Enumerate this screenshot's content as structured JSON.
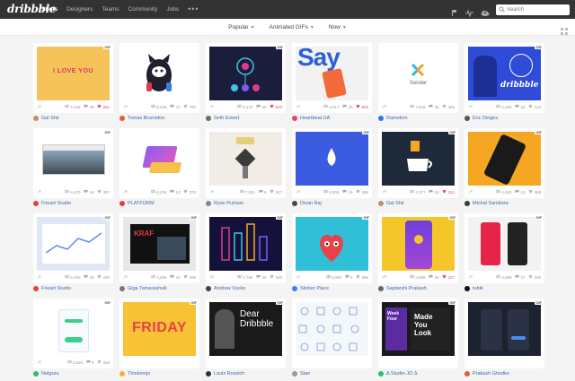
{
  "nav": {
    "logo": "dribbble",
    "items": [
      "Shots",
      "Designers",
      "Teams",
      "Community",
      "Jobs"
    ],
    "more": "•••",
    "search_placeholder": "Search"
  },
  "filters": {
    "sort": "Popular",
    "type": "Animated GIFs",
    "time": "Now"
  },
  "thumb_text": {
    "love": "I LOVE YOU",
    "say": "Say",
    "xender": "Xender",
    "dribbble_script": "dribbble",
    "friday": "FRIDAY",
    "dear": "Dear",
    "dribbble_word": "Dribbble",
    "made": "Made",
    "you": "You",
    "look": "Look",
    "kraft": "KRAF",
    "week": "Week",
    "four": "Four"
  },
  "shots": [
    {
      "author": "Gal Shir",
      "views": "7,046",
      "comments": "49",
      "likes": "801",
      "liked": true,
      "avatar_color": "#c58b6a",
      "gif": true
    },
    {
      "author": "Tomas Brunsdon",
      "views": "8,040",
      "comments": "47",
      "likes": "760",
      "liked": false,
      "avatar_color": "#e05f3a",
      "gif": false
    },
    {
      "author": "Seth Eckert",
      "views": "5,137",
      "comments": "55",
      "likes": "548",
      "liked": true,
      "avatar_color": "#6c6c6c",
      "gif": true
    },
    {
      "author": "Heartbeat UA",
      "views": "3,617",
      "comments": "29",
      "likes": "509",
      "liked": true,
      "avatar_color": "#e8416c",
      "gif": false
    },
    {
      "author": "Ramotion",
      "views": "7,918",
      "comments": "36",
      "likes": "408",
      "liked": false,
      "avatar_color": "#2e7bd6",
      "gif": false
    },
    {
      "author": "Eric Dinges",
      "views": "4,492",
      "comments": "24",
      "likes": "413",
      "liked": false,
      "avatar_color": "#555555",
      "gif": true
    },
    {
      "author": "Fireart Studio",
      "views": "5,470",
      "comments": "16",
      "likes": "397",
      "liked": false,
      "avatar_color": "#e83e3e",
      "gif": true
    },
    {
      "author": "PLATFORM",
      "views": "6,208",
      "comments": "13",
      "likes": "375",
      "liked": false,
      "avatar_color": "#e83e3e",
      "gif": false
    },
    {
      "author": "Ryan Putnam",
      "views": "7,051",
      "comments": "5",
      "likes": "347",
      "liked": false,
      "avatar_color": "#888888",
      "gif": false
    },
    {
      "author": "Divan Raj",
      "views": "6,806",
      "comments": "19",
      "likes": "386",
      "liked": false,
      "avatar_color": "#4a4a4a",
      "gif": true
    },
    {
      "author": "Gal Shir",
      "views": "4,377",
      "comments": "19",
      "likes": "334",
      "liked": true,
      "avatar_color": "#c58b6a",
      "gif": true
    },
    {
      "author": "Michal Sambora",
      "views": "4,450",
      "comments": "15",
      "likes": "388",
      "liked": false,
      "avatar_color": "#3c3c3c",
      "gif": true
    },
    {
      "author": "Fireart Studio",
      "views": "5,493",
      "comments": "18",
      "likes": "335",
      "liked": false,
      "avatar_color": "#e83e3e",
      "gif": true
    },
    {
      "author": "Giga Tamarashvili",
      "views": "4,685",
      "comments": "22",
      "likes": "398",
      "liked": false,
      "avatar_color": "#777777",
      "gif": true
    },
    {
      "author": "Andrew Vucko",
      "views": "2,784",
      "comments": "20",
      "likes": "320",
      "liked": false,
      "avatar_color": "#444444",
      "gif": true
    },
    {
      "author": "Sticker Place",
      "views": "4,060",
      "comments": "4",
      "likes": "398",
      "liked": false,
      "avatar_color": "#3b82f6",
      "gif": true
    },
    {
      "author": "Saptarshi Prakash",
      "views": "3,898",
      "comments": "20",
      "likes": "327",
      "liked": true,
      "avatar_color": "#666666",
      "gif": true
    },
    {
      "author": "tubik",
      "views": "4,098",
      "comments": "27",
      "likes": "336",
      "liked": false,
      "avatar_color": "#111111",
      "gif": true
    },
    {
      "author": "Netguru",
      "views": "3,030",
      "comments": "8",
      "likes": "308",
      "liked": false,
      "avatar_color": "#2fbf71",
      "gif": true
    },
    {
      "author": "Thinkmojo",
      "views": "",
      "comments": "",
      "likes": "",
      "liked": false,
      "avatar_color": "#f2b233",
      "gif": true
    },
    {
      "author": "Louis Rossich",
      "views": "",
      "comments": "",
      "likes": "",
      "liked": false,
      "avatar_color": "#333333",
      "gif": true
    },
    {
      "author": "Stan",
      "views": "",
      "comments": "",
      "likes": "",
      "liked": false,
      "avatar_color": "#999999",
      "gif": false
    },
    {
      "author": "Δ Studio-JO Δ",
      "views": "",
      "comments": "",
      "likes": "",
      "liked": false,
      "avatar_color": "#2fbf71",
      "gif": true
    },
    {
      "author": "Prakash Ghodke",
      "views": "",
      "comments": "",
      "likes": "",
      "liked": false,
      "avatar_color": "#e05f3a",
      "gif": true
    }
  ],
  "colors": {
    "topbar": "#333333",
    "link": "#3a6da8",
    "like": "#ea4c89"
  }
}
